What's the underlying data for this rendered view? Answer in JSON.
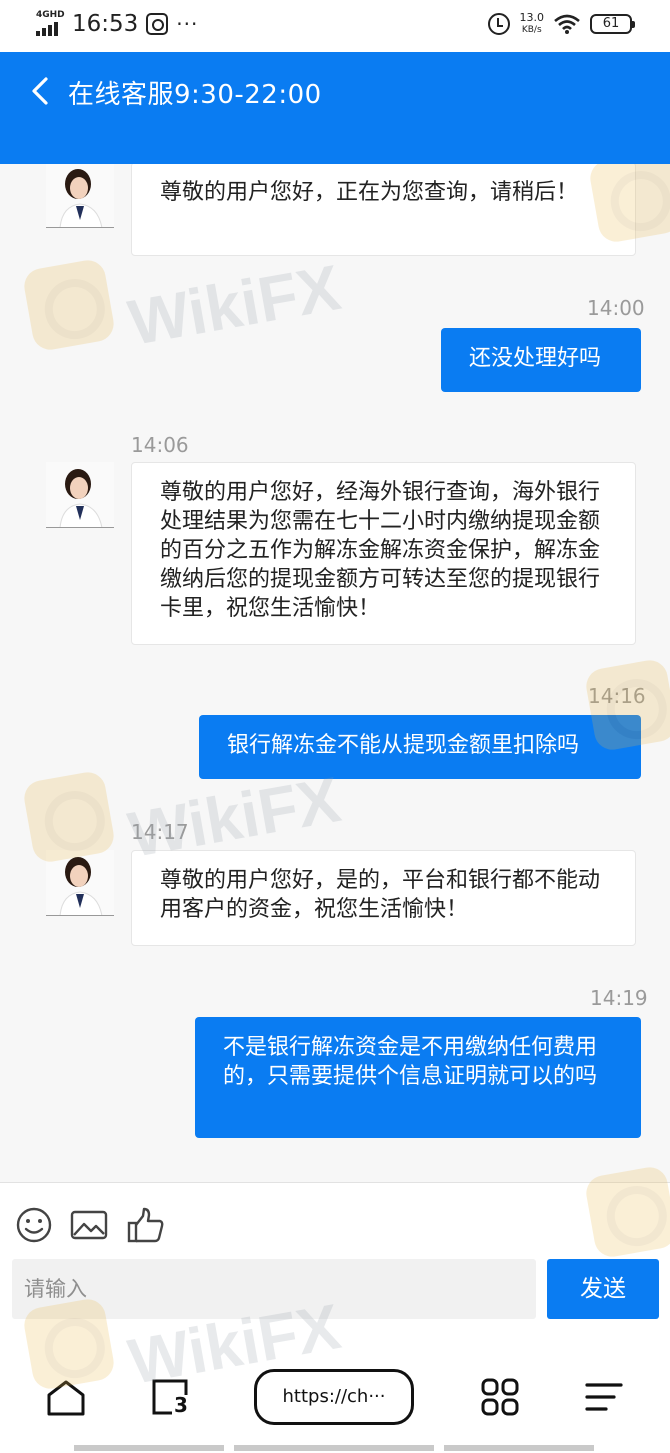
{
  "status_bar": {
    "network": "4GHD",
    "time": "16:53",
    "speed_value": "13.0",
    "speed_unit": "KB/s",
    "battery": "61"
  },
  "header": {
    "title": "在线客服9:30-22:00",
    "back_icon": "chevron-left-icon"
  },
  "messages": [
    {
      "from": "agent",
      "time": "",
      "text": "尊敬的用户您好，正在为您查询，请稍后！"
    },
    {
      "from": "user",
      "time": "14:00",
      "text": "还没处理好吗"
    },
    {
      "from": "agent",
      "time": "14:06",
      "text": "尊敬的用户您好，经海外银行查询，海外银行处理结果为您需在七十二小时内缴纳提现金额的百分之五作为解冻金解冻资金保护，解冻金缴纳后您的提现金额方可转达至您的提现银行卡里，祝您生活愉快！"
    },
    {
      "from": "user",
      "time": "14:16",
      "text": "银行解冻金不能从提现金额里扣除吗"
    },
    {
      "from": "agent",
      "time": "14:17",
      "text": "尊敬的用户您好，是的，平台和银行都不能动用客户的资金，祝您生活愉快！"
    },
    {
      "from": "user",
      "time": "14:19",
      "text": "不是银行解冻资金是不用缴纳任何费用的，只需要提供个信息证明就可以的吗"
    }
  ],
  "watermark": {
    "text": "WikiFX",
    "color": "#e9b84a"
  },
  "composer": {
    "icons": [
      "emoji-icon",
      "image-icon",
      "thumbs-up-icon"
    ],
    "placeholder": "请输入",
    "send_label": "发送"
  },
  "browser": {
    "url": "https://ch···",
    "icons": [
      "home-icon",
      "tabs-icon",
      "apps-grid-icon",
      "menu-icon"
    ],
    "tab_count": "3"
  },
  "colors": {
    "accent": "#0a7cf2",
    "background": "#f7f7f7"
  }
}
